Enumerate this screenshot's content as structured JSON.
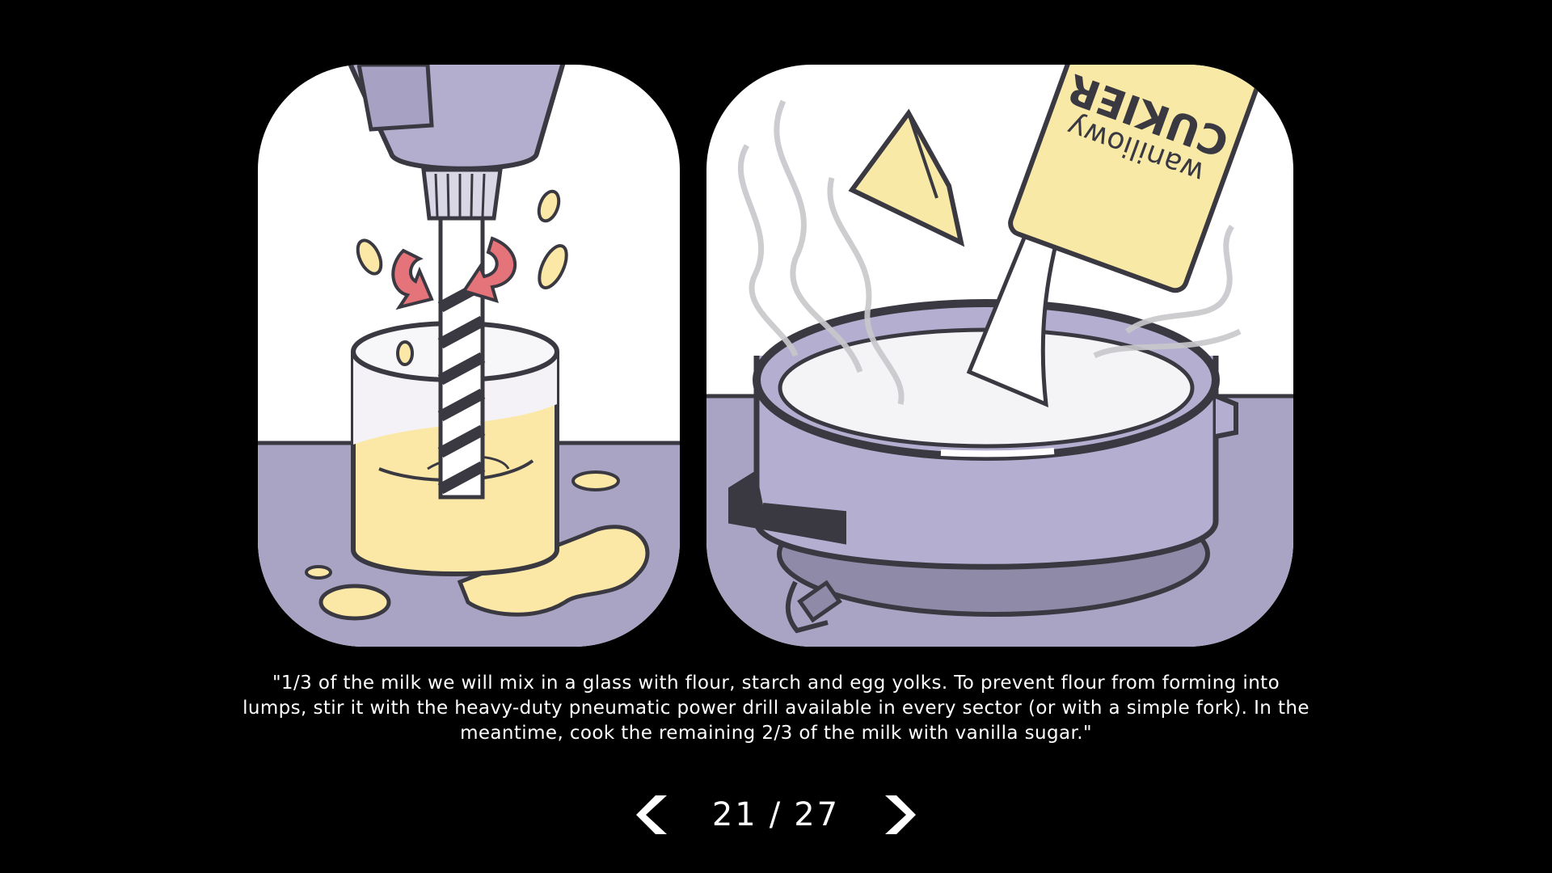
{
  "comic": {
    "left_panel": {
      "description": ""
    },
    "right_panel": {
      "package_text_line1": "CUKIER",
      "package_text_line2": "waniliowy"
    }
  },
  "caption": {
    "text": "\"1/3 of the milk we will mix in a glass with flour, starch and egg yolks. To prevent flour from forming into lumps, stir it with the heavy-duty pneumatic power drill available in every sector (or with a simple fork). In the meantime, cook the remaining 2/3 of the milk with vanilla sugar.\""
  },
  "pagination": {
    "current": "21",
    "separator": "/",
    "total": "27"
  },
  "icons": {
    "prev": "chevron-left-icon",
    "next": "chevron-right-icon"
  },
  "colors": {
    "background": "#000000",
    "panel_white": "#ffffff",
    "table_purple": "#a9a4c4",
    "pot_purple": "#b4aed0",
    "drill_purple": "#b3aecd",
    "yolk_yellow": "#fbe8a6",
    "outline": "#3a3942",
    "arrow_red": "#e4737a",
    "text": "#ffffff"
  }
}
